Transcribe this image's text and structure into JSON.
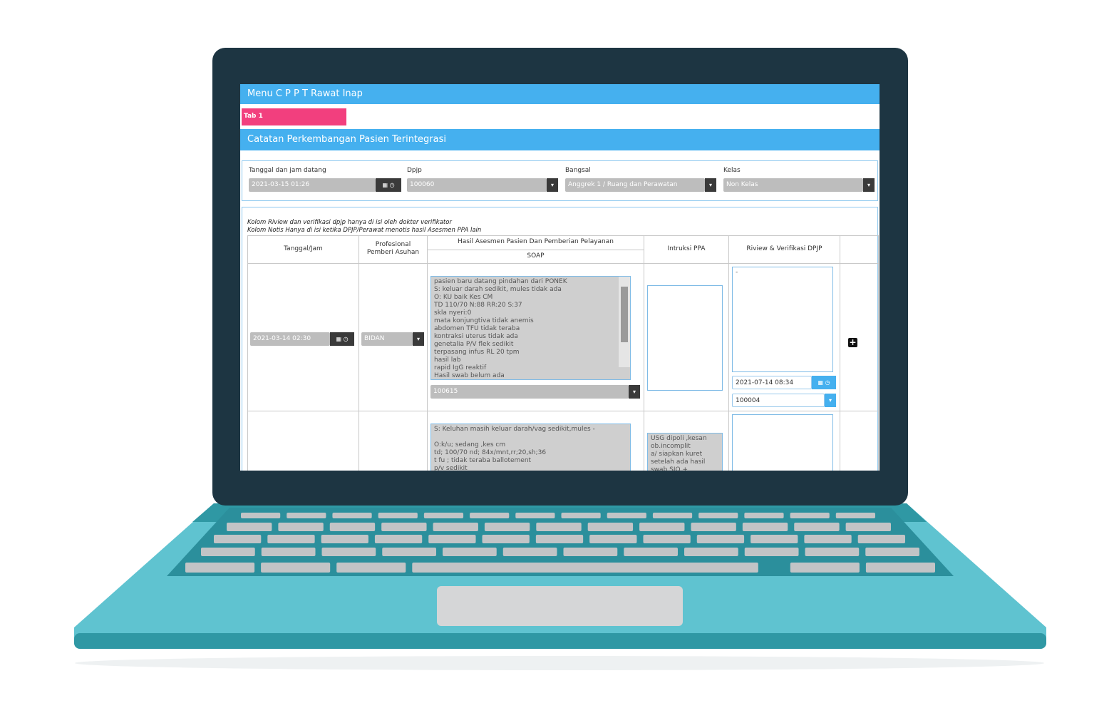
{
  "header": {
    "menu_title": "Menu C P P T Rawat Inap",
    "tab_label": "Tab 1",
    "section_title": "Catatan Perkembangan Pasien Terintegrasi"
  },
  "filters": {
    "arrival_label": "Tanggal dan jam datang",
    "arrival_value": "2021-03-15 01:26",
    "dpjp_label": "Dpjp",
    "dpjp_value": "100060",
    "ward_label": "Bangsal",
    "ward_value": "Anggrek 1 / Ruang dan Perawatan",
    "class_label": "Kelas",
    "class_value": "Non Kelas"
  },
  "notes": {
    "line1": "Kolom Riview dan verifikasi dpjp hanya di isi oleh dokter verifikator",
    "line2": "Kolom Notis Hanya di isi ketika DPJP/Perawat menotis hasil Asesmen PPA lain"
  },
  "table": {
    "headers": {
      "date": "Tanggal/Jam",
      "professional": "Profesional\nPemberi Asuhan",
      "assessment": "Hasil Asesmen Pasien Dan Pemberian Pelayanan",
      "soap": "SOAP",
      "instruction": "Intruksi PPA",
      "review": "Riview & Verifikasi DPJP"
    },
    "rows": [
      {
        "date": "2021-03-14 02:30",
        "professional": "BIDAN",
        "soap": "pasien baru datang pindahan dari PONEK\nS: keluar darah sedikit, mules tidak ada\nO: KU baik Kes CM\nTD 110/70 N:88 RR:20 S:37\nskla nyeri:0\nmata konjungtiva tidak anemis\nabdomen TFU tidak teraba\nkontraksi uterus tidak ada\ngenetalia P/V flek sedikit\nterpasang infus RL 20 tpm\nhasil lab\nrapid IgG reaktif\nHasil swab belum ada",
        "soap_select": "100615",
        "instruction": "",
        "review": "-",
        "review_date": "2021-07-14 08:34",
        "review_select": "100004"
      },
      {
        "soap": "S: Keluhan masih keluar darah/vag sedikit,mules -\n\nO:k/u; sedang ,kes cm\ntd; 100/70 nd; 84x/mnt,rr;20,sh;36\nt fu ; tidak teraba ballotement\np/v sedikit",
        "instruction": "USG dipoli ,kesan\nob.incomplit\na/ siapkan kuret\nsetelah ada hasil\nswab SIO +"
      }
    ]
  },
  "icons": {
    "calendar": "calendar-icon",
    "clock": "clock-icon",
    "caret": "caret-down-icon",
    "plus": "plus-square-icon"
  },
  "colors": {
    "header_blue": "#45b0ef",
    "tab_pink": "#f23f7e",
    "laptop_bezel": "#1d3542",
    "laptop_body": "#5fc3d0"
  }
}
